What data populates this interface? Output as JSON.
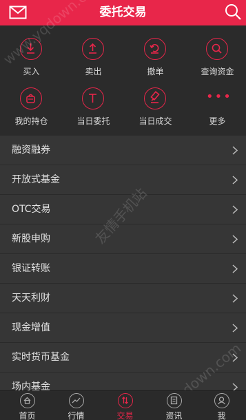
{
  "header": {
    "title": "委托交易",
    "left_icon": "mail-icon",
    "right_icon": "search-icon"
  },
  "colors": {
    "accent": "#e8264a",
    "background": "#2b2b2b",
    "row": "#363636"
  },
  "grid": {
    "tiles": [
      {
        "label": "买入",
        "icon": "buy-download-icon"
      },
      {
        "label": "卖出",
        "icon": "sell-upload-icon"
      },
      {
        "label": "撤单",
        "icon": "cancel-order-icon"
      },
      {
        "label": "查询资金",
        "icon": "query-funds-icon"
      },
      {
        "label": "我的持仓",
        "icon": "holdings-bag-icon"
      },
      {
        "label": "当日委托",
        "icon": "today-orders-icon"
      },
      {
        "label": "当日成交",
        "icon": "today-deals-icon"
      },
      {
        "label": "更多",
        "icon": "more-dots-icon"
      }
    ]
  },
  "list": {
    "items": [
      {
        "label": "融资融券"
      },
      {
        "label": "开放式基金"
      },
      {
        "label": "OTC交易"
      },
      {
        "label": "新股申购"
      },
      {
        "label": "银证转账"
      },
      {
        "label": "天天利财"
      },
      {
        "label": "现金增值"
      },
      {
        "label": "实时货币基金"
      },
      {
        "label": "场内基金"
      }
    ]
  },
  "tabbar": {
    "tabs": [
      {
        "label": "首页",
        "icon": "home-icon",
        "active": false
      },
      {
        "label": "行情",
        "icon": "market-chart-icon",
        "active": false
      },
      {
        "label": "交易",
        "icon": "trade-icon",
        "active": true
      },
      {
        "label": "资讯",
        "icon": "news-icon",
        "active": false
      },
      {
        "label": "我",
        "icon": "profile-icon",
        "active": false
      }
    ]
  },
  "watermarks": [
    "www.yqdown.com",
    "友情手机站",
    "www.yqdown.com"
  ]
}
